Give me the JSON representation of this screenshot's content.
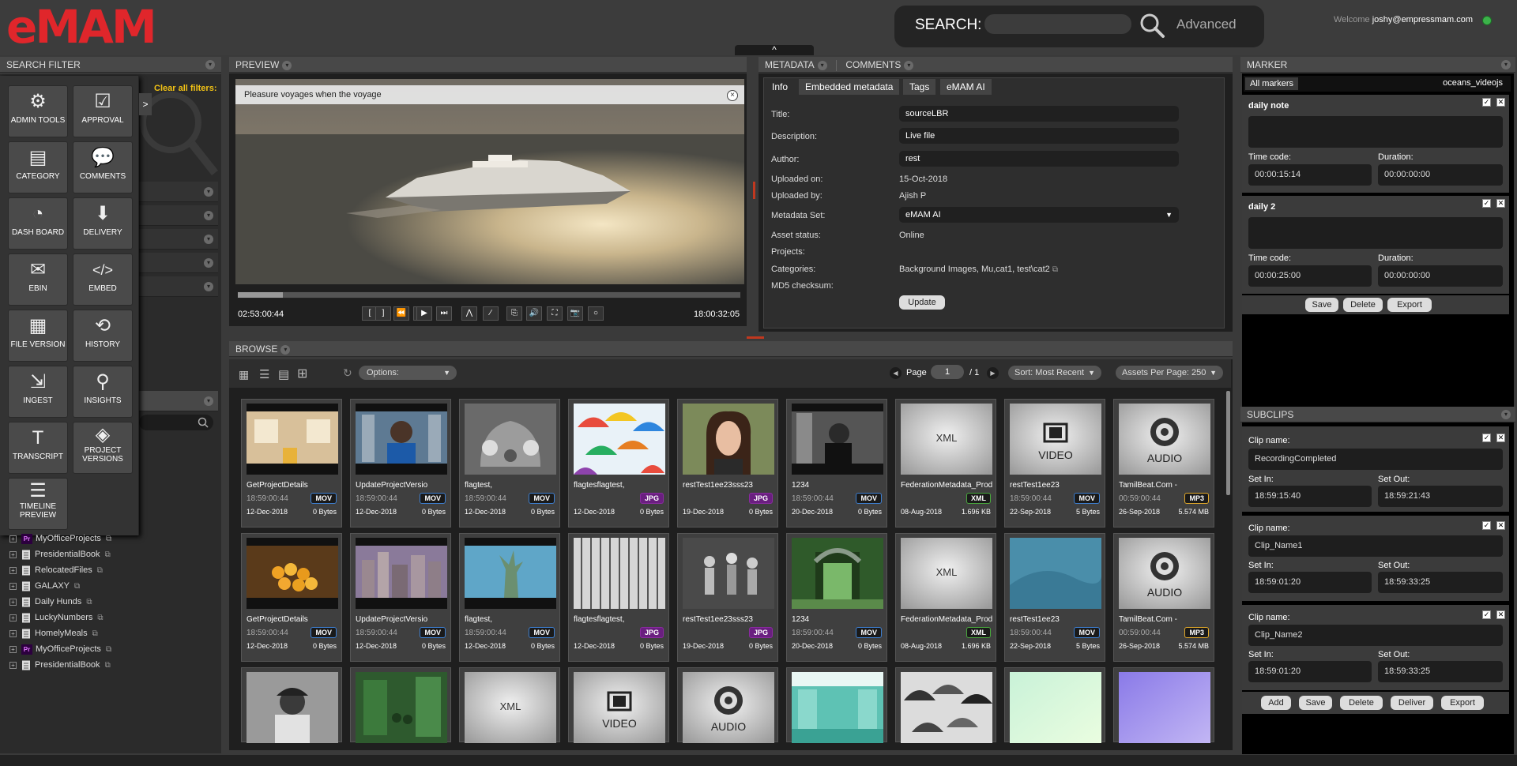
{
  "header": {
    "logo": "eMAM",
    "search_label": "SEARCH:",
    "search_placeholder": "",
    "advanced_label": "Advanced",
    "welcome_prefix": "Welcome",
    "user": "joshy@empressmam.com",
    "collapse_glyph": "^"
  },
  "search_filter": {
    "title": "SEARCH FILTER",
    "clear_all": "Clear all filters:",
    "menu_arrow": ">",
    "tools": [
      {
        "icon": "admin-tools-icon",
        "label": "ADMIN TOOLS",
        "glyph": "⚙"
      },
      {
        "icon": "approval-icon",
        "label": "APPROVAL",
        "glyph": "☑"
      },
      {
        "icon": "category-icon",
        "label": "CATEGORY",
        "glyph": "▤"
      },
      {
        "icon": "comments-icon",
        "label": "COMMENTS",
        "glyph": "💬"
      },
      {
        "icon": "dashboard-icon",
        "label": "DASH BOARD",
        "glyph": "◔"
      },
      {
        "icon": "delivery-icon",
        "label": "DELIVERY",
        "glyph": "⬇"
      },
      {
        "icon": "ebin-icon",
        "label": "EBIN",
        "glyph": "✉"
      },
      {
        "icon": "embed-icon",
        "label": "EMBED",
        "glyph": "</>"
      },
      {
        "icon": "file-version-icon",
        "label": "FILE VERSION",
        "glyph": "▦"
      },
      {
        "icon": "history-icon",
        "label": "HISTORY",
        "glyph": "⟲"
      },
      {
        "icon": "ingest-icon",
        "label": "INGEST",
        "glyph": "⇲"
      },
      {
        "icon": "insights-icon",
        "label": "INSIGHTS",
        "glyph": "⚲"
      },
      {
        "icon": "transcript-icon",
        "label": "TRANSCRIPT",
        "glyph": "T"
      },
      {
        "icon": "project-versions-icon",
        "label": "PROJECT VERSIONS",
        "glyph": "◈"
      },
      {
        "icon": "timeline-preview-icon",
        "label": "TIMELINE PREVIEW",
        "glyph": "☰"
      }
    ],
    "tree": [
      {
        "label": "MyOfficeProjects",
        "type": "premiere"
      },
      {
        "label": "PresidentialBook",
        "type": "file"
      },
      {
        "label": "RelocatedFiles",
        "type": "file"
      },
      {
        "label": "GALAXY",
        "type": "file"
      },
      {
        "label": "Daily Hunds",
        "type": "file"
      },
      {
        "label": "LuckyNumbers",
        "type": "file"
      },
      {
        "label": "HomelyMeals",
        "type": "file"
      },
      {
        "label": "MyOfficeProjects",
        "type": "premiere"
      },
      {
        "label": "PresidentialBook",
        "type": "file"
      }
    ]
  },
  "preview": {
    "title": "PREVIEW",
    "caption": "Pleasure voyages when the voyage",
    "close": "×",
    "progress": 0.09,
    "time_current": "02:53:00:44",
    "time_total": "18:00:32:05",
    "controls": [
      "[",
      "]",
      "⏪",
      "⏩",
      "▶",
      "⏭",
      "⋀",
      "∕",
      "⎘",
      "🔊",
      "⛶",
      "📷",
      "○"
    ]
  },
  "metadata": {
    "title": "METADATA",
    "comments_title": "COMMENTS",
    "tabs": [
      "Info",
      "Embedded metadata",
      "Tags",
      "eMAM AI"
    ],
    "labels": {
      "title": "Title:",
      "description": "Description:",
      "author": "Author:",
      "uploaded_on": "Uploaded on:",
      "uploaded_by": "Uploaded by:",
      "metadata_set": "Metadata Set:",
      "asset_status": "Asset status:",
      "projects": "Projects:",
      "categories": "Categories:",
      "md5": "MD5 checksum:"
    },
    "values": {
      "title": "sourceLBR",
      "description": "Live file",
      "author": "rest",
      "uploaded_on": "15-Oct-2018",
      "uploaded_by": "Ajish P",
      "metadata_set": "eMAM AI",
      "asset_status": "Online",
      "categories": "Background Images, Mu,cat1, test\\cat2"
    },
    "update_label": "Update"
  },
  "browse": {
    "title": "BROWSE",
    "options_label": "Options:",
    "page_label": "Page",
    "page_value": "1",
    "page_total": "/ 1",
    "sort_label": "Sort: Most Recent",
    "per_page_label": "Assets Per Page: 250",
    "row1": [
      {
        "name": "GetProjectDetails",
        "time": "18:59:00:44",
        "badge": "MOV",
        "date": "12-Dec-2018",
        "size": "0 Bytes",
        "thumb": "train"
      },
      {
        "name": "UpdateProjectVersio",
        "time": "18:59:00:44",
        "badge": "MOV",
        "date": "12-Dec-2018",
        "size": "0 Bytes",
        "thumb": "hiphop"
      },
      {
        "name": "flagtest,",
        "time": "18:59:00:44",
        "badge": "MOV",
        "date": "12-Dec-2018",
        "size": "0 Bytes",
        "thumb": "beetle"
      },
      {
        "name": "flagtesflagtest,",
        "time": "",
        "badge": "JPG",
        "date": "12-Dec-2018",
        "size": "0 Bytes",
        "thumb": "umbrellas"
      },
      {
        "name": "restTest1ee23sss23",
        "time": "",
        "badge": "JPG",
        "date": "19-Dec-2018",
        "size": "0 Bytes",
        "thumb": "woman"
      },
      {
        "name": "1234",
        "time": "18:59:00:44",
        "badge": "MOV",
        "date": "20-Dec-2018",
        "size": "0 Bytes",
        "thumb": "bw"
      },
      {
        "name": "FederationMetadata_Prod",
        "time": "",
        "badge": "XML",
        "date": "08-Aug-2018",
        "size": "1.696 KB",
        "thumb": "xml"
      },
      {
        "name": "restTest1ee23",
        "time": "18:59:00:44",
        "badge": "MOV",
        "date": "22-Sep-2018",
        "size": "5 Bytes",
        "thumb": "video"
      },
      {
        "name": "TamilBeat.Com -",
        "time": "00:59:00:44",
        "badge": "MP3",
        "date": "26-Sep-2018",
        "size": "5.574 MB",
        "thumb": "audio"
      }
    ],
    "row2": [
      {
        "name": "GetProjectDetails",
        "time": "18:59:00:44",
        "badge": "MOV",
        "date": "12-Dec-2018",
        "size": "0 Bytes",
        "thumb": "fruit"
      },
      {
        "name": "UpdateProjectVersio",
        "time": "18:59:00:44",
        "badge": "MOV",
        "date": "12-Dec-2018",
        "size": "0 Bytes",
        "thumb": "city"
      },
      {
        "name": "flagtest,",
        "time": "18:59:00:44",
        "badge": "MOV",
        "date": "12-Dec-2018",
        "size": "0 Bytes",
        "thumb": "liberty"
      },
      {
        "name": "flagtesflagtest,",
        "time": "",
        "badge": "JPG",
        "date": "12-Dec-2018",
        "size": "0 Bytes",
        "thumb": "building"
      },
      {
        "name": "restTest1ee23sss23",
        "time": "",
        "badge": "JPG",
        "date": "19-Dec-2018",
        "size": "0 Bytes",
        "thumb": "dancers"
      },
      {
        "name": "1234",
        "time": "18:59:00:44",
        "badge": "MOV",
        "date": "20-Dec-2018",
        "size": "0 Bytes",
        "thumb": "gate"
      },
      {
        "name": "FederationMetadata_Prod",
        "time": "",
        "badge": "XML",
        "date": "08-Aug-2018",
        "size": "1.696 KB",
        "thumb": "xml"
      },
      {
        "name": "restTest1ee23",
        "time": "18:59:00:44",
        "badge": "MOV",
        "date": "22-Sep-2018",
        "size": "5 Bytes",
        "thumb": "blue"
      },
      {
        "name": "TamilBeat.Com -",
        "time": "00:59:00:44",
        "badge": "MP3",
        "date": "26-Sep-2018",
        "size": "5.574 MB",
        "thumb": "audio"
      }
    ],
    "row3": [
      "rapper",
      "green",
      "xml",
      "video",
      "audio",
      "subway",
      "umbrellabw",
      "mint",
      "lavender"
    ]
  },
  "marker": {
    "title": "MARKER",
    "tab_all": "All markers",
    "asset": "oceans_videojs",
    "items": [
      {
        "name": "daily note",
        "tc_label": "Time code:",
        "tc": "00:00:15:14",
        "dur_label": "Duration:",
        "dur": "00:00:00:00"
      },
      {
        "name": "daily 2",
        "tc_label": "Time code:",
        "tc": "00:00:25:00",
        "dur_label": "Duration:",
        "dur": "00:00:00:00"
      }
    ],
    "save": "Save",
    "delete": "Delete",
    "export": "Export"
  },
  "subclips": {
    "title": "SUBCLIPS",
    "items": [
      {
        "name_label": "Clip name:",
        "name": "RecordingCompleted",
        "in_label": "Set In:",
        "in": "18:59:15:40",
        "out_label": "Set Out:",
        "out": "18:59:21:43"
      },
      {
        "name_label": "Clip name:",
        "name": "Clip_Name1",
        "in_label": "Set In:",
        "in": "18:59:01:20",
        "out_label": "Set Out:",
        "out": "18:59:33:25"
      },
      {
        "name_label": "Clip name:",
        "name": "Clip_Name2",
        "in_label": "Set In:",
        "in": "18:59:01:20",
        "out_label": "Set Out:",
        "out": "18:59:33:25"
      }
    ],
    "add": "Add",
    "save": "Save",
    "delete": "Delete",
    "deliver": "Deliver",
    "export": "Export"
  },
  "colors": {
    "brand_red": "#e0262b",
    "clear_yellow": "#f2c215",
    "badge_mov": "#3d7fd1",
    "badge_jpg": "#8a2aa0",
    "badge_xml": "#48a83c",
    "badge_mp3": "#e0a82a"
  }
}
